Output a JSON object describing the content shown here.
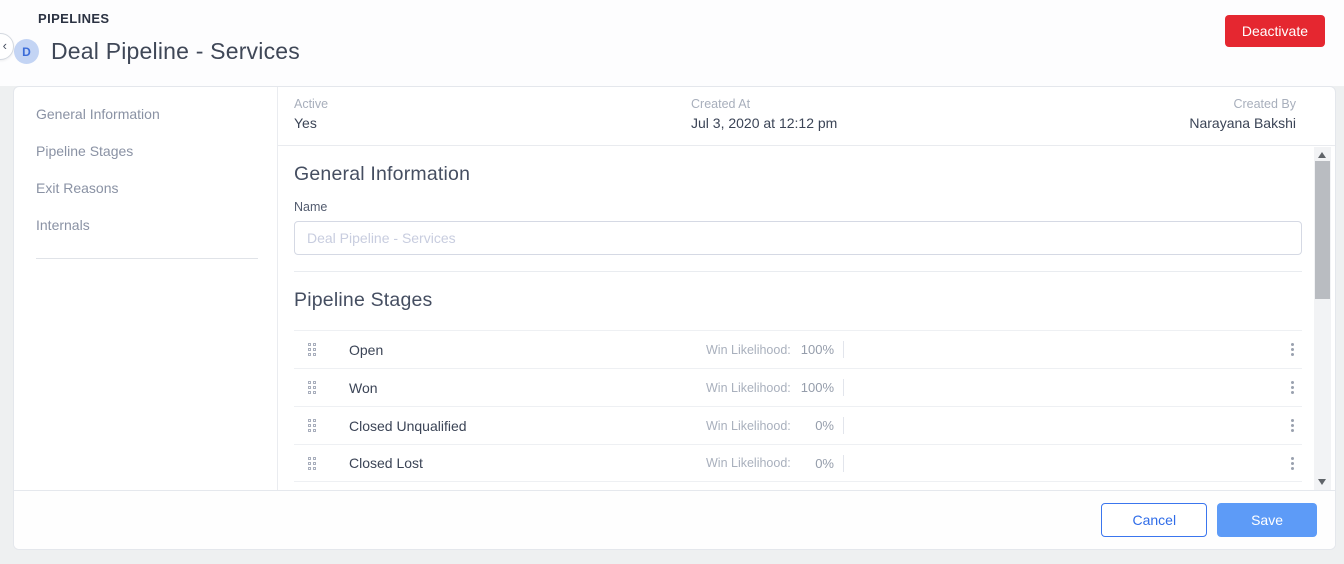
{
  "page": {
    "breadcrumb": "PIPELINES",
    "title": "Deal Pipeline - Services",
    "avatar_initial": "D",
    "deactivate_label": "Deactivate"
  },
  "sidebar": {
    "items": [
      {
        "label": "General Information"
      },
      {
        "label": "Pipeline Stages"
      },
      {
        "label": "Exit Reasons"
      },
      {
        "label": "Internals"
      }
    ]
  },
  "meta": {
    "active_label": "Active",
    "active_value": "Yes",
    "created_at_label": "Created At",
    "created_at_value": "Jul 3, 2020 at 12:12 pm",
    "created_by_label": "Created By",
    "created_by_value": "Narayana Bakshi"
  },
  "general_information": {
    "heading": "General Information",
    "name_label": "Name",
    "name_value": "",
    "name_placeholder": "Deal Pipeline - Services"
  },
  "pipeline_stages": {
    "heading": "Pipeline Stages",
    "win_likelihood_label": "Win Likelihood:",
    "stages": [
      {
        "name": "Open",
        "win_likelihood": "100%"
      },
      {
        "name": "Won",
        "win_likelihood": "100%"
      },
      {
        "name": "Closed Unqualified",
        "win_likelihood": "0%"
      },
      {
        "name": "Closed Lost",
        "win_likelihood": "0%"
      }
    ]
  },
  "footer": {
    "cancel_label": "Cancel",
    "save_label": "Save"
  },
  "icons": {
    "back": "back-chevron-icon",
    "drag": "drag-handle-icon",
    "row_menu": "kebab-menu-icon",
    "scroll_up": "scroll-up-arrow-icon",
    "scroll_down": "scroll-down-arrow-icon"
  },
  "colors": {
    "danger_red": "#e52730",
    "accent_blue": "#2f6ce8",
    "save_blue": "#5d9bf7",
    "avatar_bg": "#c3d4f4",
    "avatar_text": "#3b6cd8",
    "page_background": "#eef0f1"
  }
}
